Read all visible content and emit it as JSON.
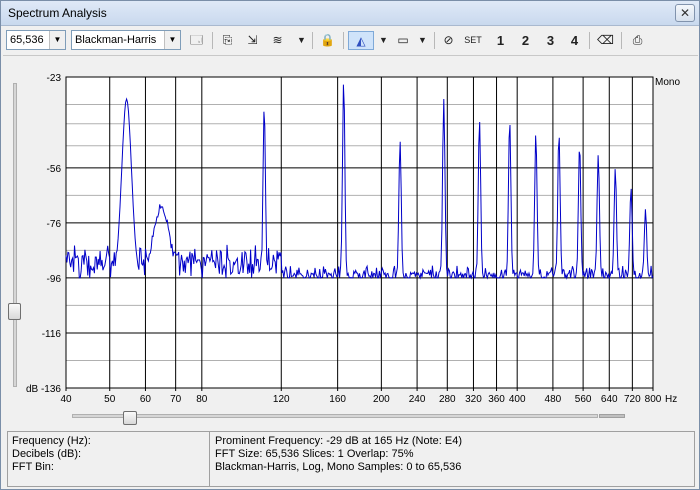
{
  "window": {
    "title": "Spectrum Analysis"
  },
  "toolbar": {
    "size_value": "65,536",
    "window_value": "Blackman-Harris",
    "set_label": "SET",
    "num1": "1",
    "num2": "2",
    "num3": "3",
    "num4": "4"
  },
  "chart_data": {
    "type": "line",
    "x_scale": "log",
    "xlim": [
      40,
      800
    ],
    "ylim": [
      -136,
      -23
    ],
    "x_ticks": [
      40,
      50,
      60,
      70,
      80,
      120,
      160,
      200,
      240,
      280,
      320,
      360,
      400,
      480,
      560,
      640,
      720,
      800
    ],
    "x_tick_labels": [
      "40",
      "50",
      "60",
      "70",
      "80",
      "120",
      "160",
      "200",
      "240",
      "280",
      "320",
      "360",
      "400",
      "480",
      "560",
      "640",
      "720",
      "800"
    ],
    "y_ticks": [
      -23,
      -56,
      -76,
      -96,
      -116,
      -136
    ],
    "y_tick_labels": [
      "-23",
      "-56",
      "-76",
      "-96",
      "-116",
      "dB -136"
    ],
    "xlabel": "Hz",
    "channel_label": "Mono",
    "grid": true,
    "line_color": "#0000c8",
    "baseline_db": -96,
    "peaks": [
      {
        "x": 54.5,
        "y": -31
      },
      {
        "x": 110,
        "y": -33
      },
      {
        "x": 165,
        "y": -24
      },
      {
        "x": 220,
        "y": -46
      },
      {
        "x": 275,
        "y": -31
      },
      {
        "x": 330,
        "y": -38
      },
      {
        "x": 385,
        "y": -38
      },
      {
        "x": 440,
        "y": -43
      },
      {
        "x": 495,
        "y": -43
      },
      {
        "x": 550,
        "y": -47
      },
      {
        "x": 605,
        "y": -51
      },
      {
        "x": 660,
        "y": -56
      },
      {
        "x": 715,
        "y": -63
      },
      {
        "x": 770,
        "y": -71
      }
    ]
  },
  "status": {
    "frequency_label": "Frequency (Hz):",
    "decibels_label": "Decibels (dB):",
    "fftbin_label": "FFT Bin:",
    "prominent": "Prominent Frequency: -29 dB at 165 Hz (Note: E4)",
    "fft_info": "FFT Size: 65,536  Slices: 1  Overlap: 75%",
    "window_info": "Blackman-Harris, Log, Mono  Samples: 0 to 65,536"
  }
}
